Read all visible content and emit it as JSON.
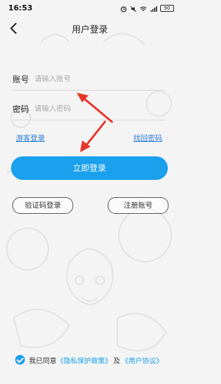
{
  "status_bar": {
    "time": "16:53",
    "battery": "90"
  },
  "header": {
    "title": "用户登录"
  },
  "form": {
    "account": {
      "label": "账号",
      "placeholder": "请输入账号"
    },
    "password": {
      "label": "密码",
      "placeholder": "请输入密码"
    }
  },
  "links": {
    "guest_login": "游客登录",
    "find_password": "找回密码"
  },
  "buttons": {
    "login": "立即登录",
    "code_login": "验证码登录",
    "register": "注册账号"
  },
  "agreement": {
    "prefix": "我已同意",
    "privacy": "《隐私保护政策》",
    "and": "及",
    "user_agreement": "《用户协议》",
    "checked": true
  },
  "colors": {
    "accent": "#1aa0ec",
    "link": "#2c7fd8",
    "annotation_arrow": "#e8352a"
  }
}
